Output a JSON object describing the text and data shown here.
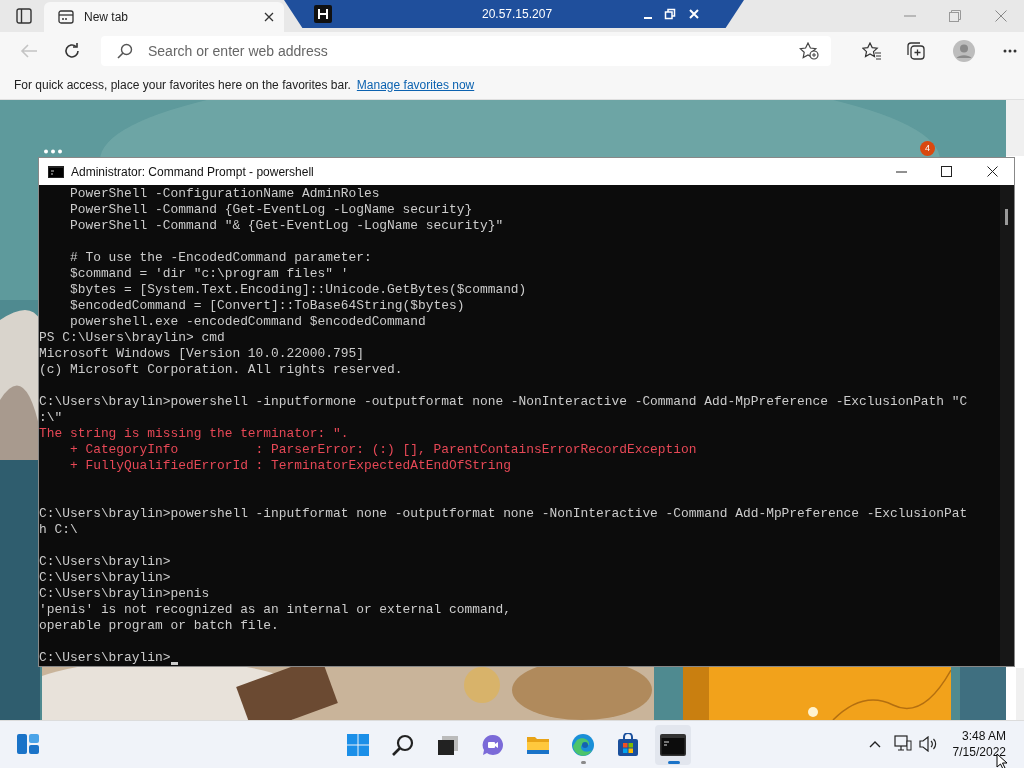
{
  "browser": {
    "tabs": [
      {
        "label": "New tab",
        "selected": true
      }
    ],
    "remote_bar": {
      "address": "20.57.15.207"
    },
    "address_bar": {
      "placeholder": "Search or enter web address"
    },
    "favorites_bar": {
      "message": "For quick access, place your favorites here on the favorites bar.",
      "link": "Manage favorites now"
    }
  },
  "new_tab_page": {
    "notification_count": "4"
  },
  "terminal": {
    "title": "Administrator: Command Prompt - powershell",
    "lines": [
      {
        "kind": "output",
        "text": "    PowerShell -ConfigurationName AdminRoles"
      },
      {
        "kind": "output",
        "text": "    PowerShell -Command {Get-EventLog -LogName security}"
      },
      {
        "kind": "output",
        "text": "    PowerShell -Command \"& {Get-EventLog -LogName security}\""
      },
      {
        "kind": "blank"
      },
      {
        "kind": "output",
        "text": "    # To use the -EncodedCommand parameter:"
      },
      {
        "kind": "output",
        "text": "    $command = 'dir \"c:\\program files\" '"
      },
      {
        "kind": "output",
        "text": "    $bytes = [System.Text.Encoding]::Unicode.GetBytes($command)"
      },
      {
        "kind": "output",
        "text": "    $encodedCommand = [Convert]::ToBase64String($bytes)"
      },
      {
        "kind": "output",
        "text": "    powershell.exe -encodedCommand $encodedCommand"
      },
      {
        "kind": "output",
        "text": "PS C:\\Users\\braylin> cmd"
      },
      {
        "kind": "output",
        "text": "Microsoft Windows [Version 10.0.22000.795]"
      },
      {
        "kind": "output",
        "text": "(c) Microsoft Corporation. All rights reserved."
      },
      {
        "kind": "blank"
      },
      {
        "kind": "output",
        "text": "C:\\Users\\braylin>powershell -inputformone -outputformat none -NonInteractive -Command Add-MpPreference -ExclusionPath \"C"
      },
      {
        "kind": "output",
        "text": ":\\\""
      },
      {
        "kind": "error",
        "text": "The string is missing the terminator: \"."
      },
      {
        "kind": "error",
        "text": "    + CategoryInfo          : ParserError: (:) [], ParentContainsErrorRecordException"
      },
      {
        "kind": "error",
        "text": "    + FullyQualifiedErrorId : TerminatorExpectedAtEndOfString"
      },
      {
        "kind": "blank"
      },
      {
        "kind": "blank"
      },
      {
        "kind": "output",
        "text": "C:\\Users\\braylin>powershell -inputformat none -outputformat none -NonInteractive -Command Add-MpPreference -ExclusionPat"
      },
      {
        "kind": "output",
        "text": "h C:\\"
      },
      {
        "kind": "blank"
      },
      {
        "kind": "output",
        "text": "C:\\Users\\braylin>"
      },
      {
        "kind": "output",
        "text": "C:\\Users\\braylin>"
      },
      {
        "kind": "output",
        "text": "C:\\Users\\braylin>penis"
      },
      {
        "kind": "output",
        "text": "'penis' is not recognized as an internal or external command,"
      },
      {
        "kind": "output",
        "text": "operable program or batch file."
      },
      {
        "kind": "blank"
      },
      {
        "kind": "prompt",
        "text": "C:\\Users\\braylin>"
      }
    ]
  },
  "taskbar": {
    "apps": [
      {
        "kind": "start",
        "open": false,
        "focused": false
      },
      {
        "kind": "search",
        "open": false,
        "focused": false
      },
      {
        "kind": "task-view",
        "open": false,
        "focused": false
      },
      {
        "kind": "chat",
        "open": false,
        "focused": false
      },
      {
        "kind": "file-explorer",
        "open": false,
        "focused": false
      },
      {
        "kind": "edge",
        "open": true,
        "focused": false
      },
      {
        "kind": "store",
        "open": false,
        "focused": false
      },
      {
        "kind": "terminal",
        "open": true,
        "focused": true
      }
    ],
    "time": "3:48 AM",
    "date": "7/15/2022"
  }
}
